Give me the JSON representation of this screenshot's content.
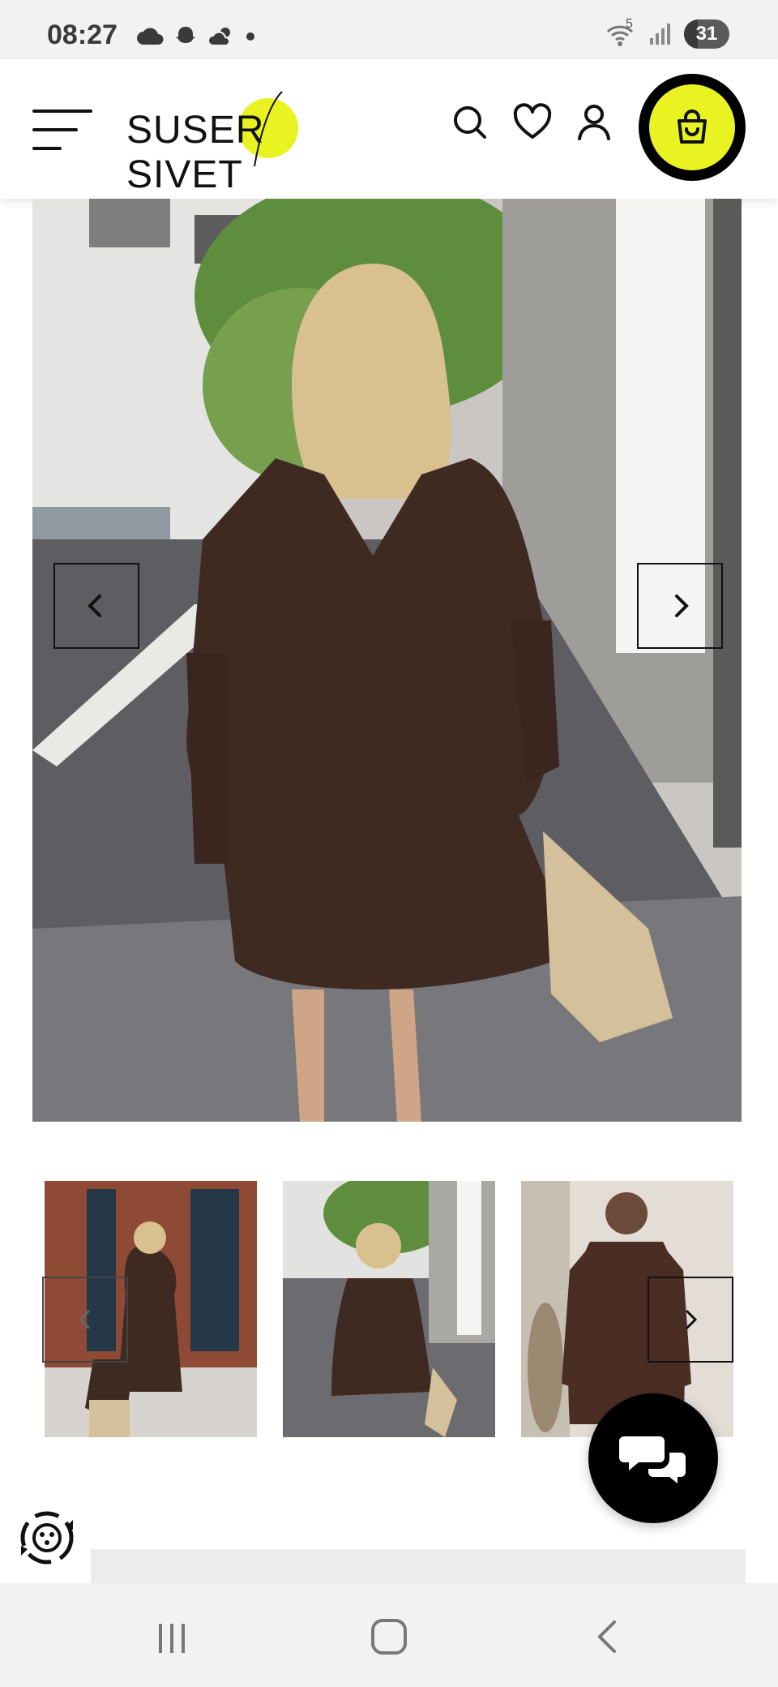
{
  "status_bar": {
    "time": "08:27",
    "notification_icons": [
      "cloud-icon",
      "snapchat-icon",
      "weather-icon",
      "dot-icon"
    ],
    "wifi_label": "5",
    "battery_level": "31",
    "battery_fraction": 0.31
  },
  "header": {
    "brand_left": "SUSER",
    "brand_right": "SIVET",
    "accent_color": "#e8f321",
    "icons": [
      "menu-icon",
      "search-icon",
      "heart-icon",
      "user-icon",
      "bag-icon"
    ]
  },
  "gallery": {
    "main_image": "woman-in-brown-dress-back-view",
    "prev_icon": "chevron-left-icon",
    "next_icon": "chevron-right-icon",
    "thumbnails": [
      {
        "name": "side-view-thumbnail"
      },
      {
        "name": "back-view-thumbnail"
      },
      {
        "name": "front-view-thumbnail"
      }
    ]
  },
  "widgets": {
    "chat_icon": "chat-bubbles-icon",
    "accessibility_icon": "accessibility-icon"
  },
  "nav_bar": {
    "icons": [
      "recent-apps-icon",
      "home-icon",
      "back-icon"
    ]
  }
}
